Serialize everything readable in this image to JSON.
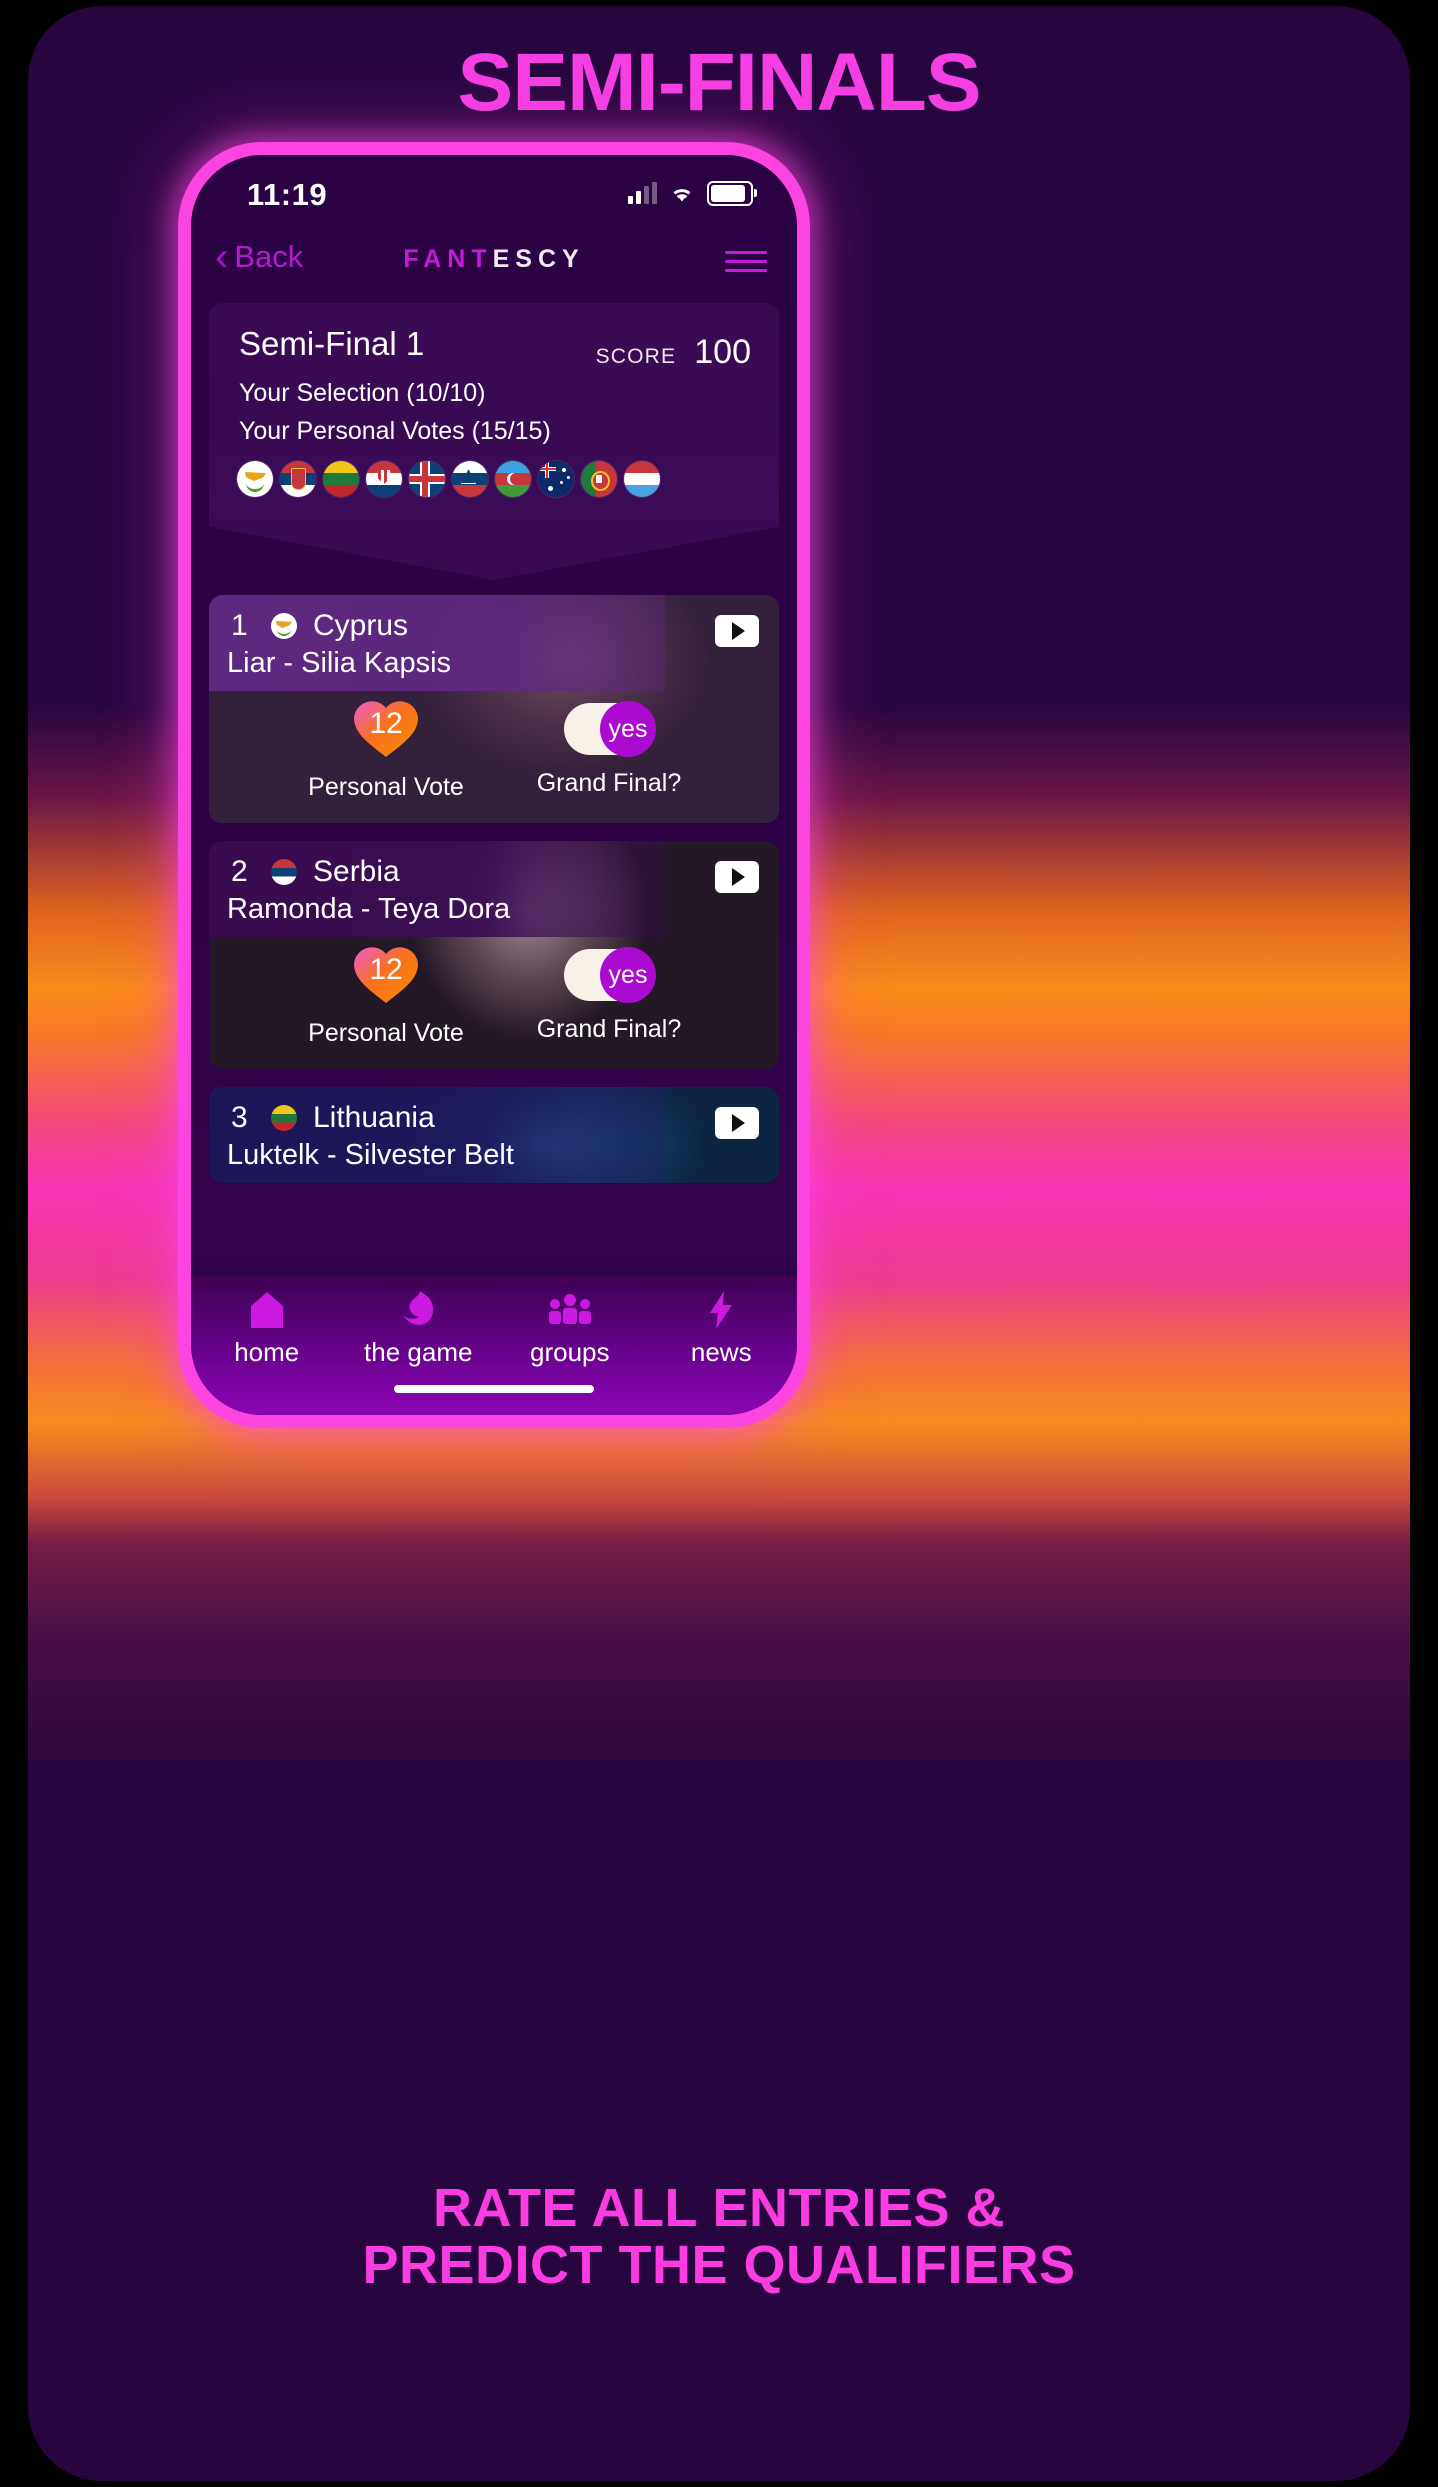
{
  "poster": {
    "headline": "SEMI-FINALS",
    "caption_line1": "RATE ALL ENTRIES &",
    "caption_line2": "PREDICT THE QUALIFIERS",
    "accent_pink": "#fb3ce0",
    "phone_border": "#fb44e0"
  },
  "status_bar": {
    "time": "11:19",
    "signal_icon": "cellular-bars-icon",
    "wifi_icon": "wifi-icon",
    "battery_icon": "battery-full-icon"
  },
  "nav": {
    "back_label": "Back",
    "back_icon": "chevron-left-icon",
    "brand_part1": "FANT",
    "brand_part2": "ESCY",
    "menu_icon": "hamburger-menu-icon"
  },
  "summary": {
    "title": "Semi-Final 1",
    "score_label": "SCORE",
    "score_value": "100",
    "selection": "Your Selection (10/10)",
    "personal_votes": "Your Personal Votes (15/15)",
    "flags": [
      {
        "name": "Cyprus",
        "code": "cy"
      },
      {
        "name": "Serbia",
        "code": "rs"
      },
      {
        "name": "Lithuania",
        "code": "lt"
      },
      {
        "name": "Croatia",
        "code": "hr"
      },
      {
        "name": "Iceland",
        "code": "is"
      },
      {
        "name": "Slovenia",
        "code": "si"
      },
      {
        "name": "Azerbaijan",
        "code": "az"
      },
      {
        "name": "Australia",
        "code": "au"
      },
      {
        "name": "Portugal",
        "code": "pt"
      },
      {
        "name": "Luxembourg",
        "code": "lu"
      }
    ]
  },
  "entries": [
    {
      "rank": "1",
      "country": "Cyprus",
      "flag_code": "cy",
      "song": "Liar - Silia Kapsis",
      "play_icon": "play-video-icon",
      "vote_value": "12",
      "vote_label": "Personal Vote",
      "toggle_value": "yes",
      "toggle_label": "Grand Final?"
    },
    {
      "rank": "2",
      "country": "Serbia",
      "flag_code": "rs",
      "song": "Ramonda - Teya Dora",
      "play_icon": "play-video-icon",
      "vote_value": "12",
      "vote_label": "Personal Vote",
      "toggle_value": "yes",
      "toggle_label": "Grand Final?"
    },
    {
      "rank": "3",
      "country": "Lithuania",
      "flag_code": "lt",
      "song": "Luktelk - Silvester Belt",
      "play_icon": "play-video-icon"
    }
  ],
  "tabbar": [
    {
      "label": "home",
      "icon": "home-icon"
    },
    {
      "label": "the game",
      "icon": "bird-icon"
    },
    {
      "label": "groups",
      "icon": "people-group-icon"
    },
    {
      "label": "news",
      "icon": "lightning-bolt-icon"
    }
  ]
}
